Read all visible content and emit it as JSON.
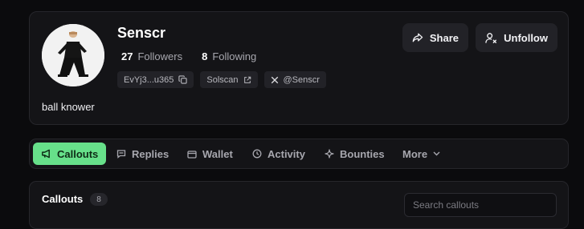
{
  "profile": {
    "name": "Senscr",
    "followers_count": "27",
    "followers_label": "Followers",
    "following_count": "8",
    "following_label": "Following",
    "bio": "ball knower"
  },
  "chips": {
    "wallet_address": "EvYj3...u365",
    "solscan_label": "Solscan",
    "x_handle": "@Senscr"
  },
  "actions": {
    "share_label": "Share",
    "unfollow_label": "Unfollow"
  },
  "tabs": [
    {
      "label": "Callouts",
      "active": true,
      "icon": "megaphone-icon"
    },
    {
      "label": "Replies",
      "active": false,
      "icon": "message-icon"
    },
    {
      "label": "Wallet",
      "active": false,
      "icon": "wallet-icon"
    },
    {
      "label": "Activity",
      "active": false,
      "icon": "clock-icon"
    },
    {
      "label": "Bounties",
      "active": false,
      "icon": "sparkle-icon"
    },
    {
      "label": "More",
      "active": false,
      "icon": "chevron-down-icon"
    }
  ],
  "section": {
    "title": "Callouts",
    "count": "8",
    "search_placeholder": "Search callouts"
  },
  "colors": {
    "background": "#0b0b0d",
    "card": "#141417",
    "accent_green": "#67e08a"
  }
}
